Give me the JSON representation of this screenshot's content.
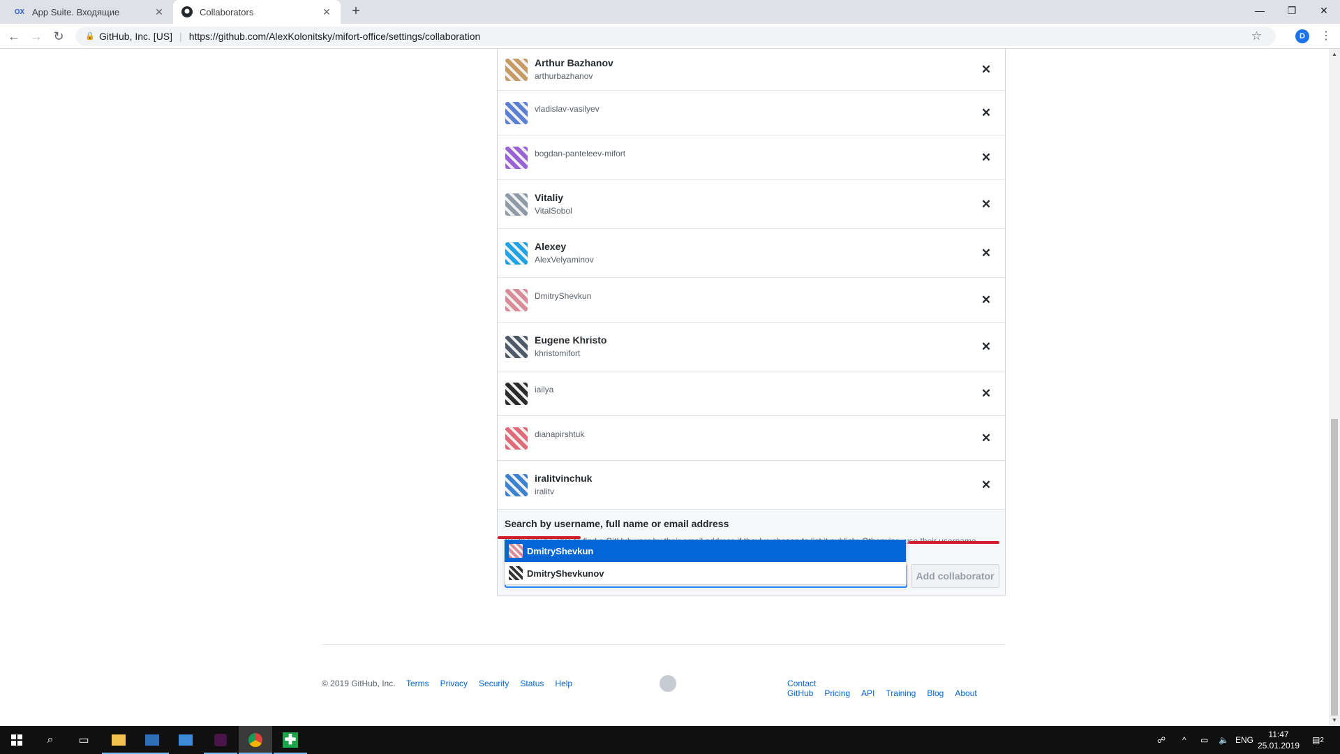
{
  "browser": {
    "tabs": [
      {
        "title": "App Suite. Входящие",
        "favicon": "OX"
      },
      {
        "title": "Collaborators",
        "favicon": "github-icon"
      }
    ],
    "address": {
      "org": "GitHub, Inc. [US]",
      "url": "https://github.com/AlexKolonitsky/mifort-office/settings/collaboration"
    },
    "profile_initial": "D"
  },
  "collaborators": [
    {
      "name": "Arthur Bazhanov",
      "login": "arthurbazhanov",
      "avatar_color": "#c89a63"
    },
    {
      "name": "",
      "login": "vladislav-vasilyev",
      "avatar_color": "#5b7fd1"
    },
    {
      "name": "",
      "login": "bogdan-panteleev-mifort",
      "avatar_color": "#9a62d3"
    },
    {
      "name": "Vitaliy",
      "login": "VitalSobol",
      "avatar_color": "#8e9aa6"
    },
    {
      "name": "Alexey",
      "login": "AlexVelyaminov",
      "avatar_color": "#1fa3e4"
    },
    {
      "name": "",
      "login": "DmitryShevkun",
      "avatar_color": "#d98b9a"
    },
    {
      "name": "Eugene Khristo",
      "login": "khristomifort",
      "avatar_color": "#4d5a68"
    },
    {
      "name": "",
      "login": "iailya",
      "avatar_color": "#2c2c2c"
    },
    {
      "name": "",
      "login": "dianapirshtuk",
      "avatar_color": "#e06b78"
    },
    {
      "name": "iralitvinchuk",
      "login": "iralitv",
      "avatar_color": "#3b82d1"
    }
  ],
  "add": {
    "heading": "Search by username, full name or email address",
    "note": "You'll only be able to find a GitHub user by their email address if they've chosen to list it publicly. Otherwise, use their username instead.",
    "input_value": "dmitryshevkun",
    "button_label": "Add collaborator"
  },
  "suggestions": [
    {
      "login": "DmitryShevkun",
      "avatar_color": "#d98b9a"
    },
    {
      "login": "DmitryShevkunov",
      "avatar_color": "#333333"
    }
  ],
  "footer": {
    "copyright": "© 2019 GitHub, Inc.",
    "left_links": [
      "Terms",
      "Privacy",
      "Security",
      "Status",
      "Help"
    ],
    "right_links": [
      "Contact GitHub",
      "Pricing",
      "API",
      "Training",
      "Blog",
      "About"
    ]
  },
  "taskbar": {
    "lang": "ENG",
    "time": "11:47",
    "date": "25.01.2019",
    "notifications": "2"
  }
}
